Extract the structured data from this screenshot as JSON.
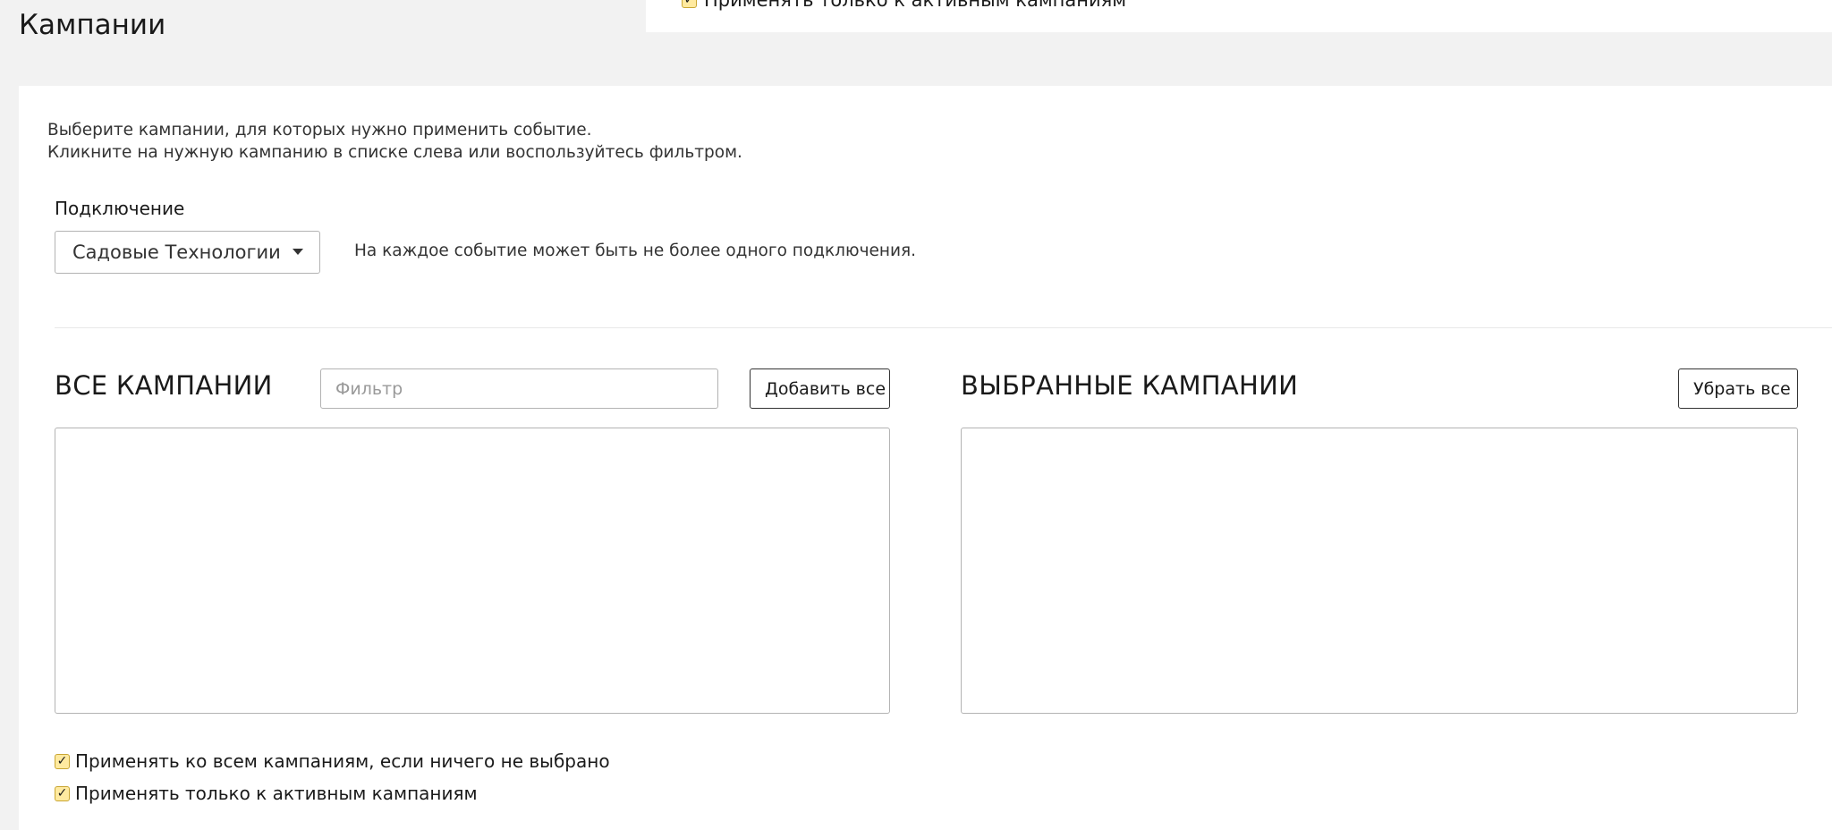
{
  "page": {
    "title": "Кампании"
  },
  "top_strip": {
    "ghost_checkbox_label": "Применять только к активным кампаниям"
  },
  "intro": {
    "line1": "Выберите кампании, для которых нужно применить событие.",
    "line2": "Кликните на нужную кампанию в списке слева или воспользуйтесь фильтром."
  },
  "connection": {
    "label": "Подключение",
    "selected_value": "Садовые Технологии",
    "note": "На каждое событие может быть не более одного подключения."
  },
  "all_campaigns": {
    "title": "ВСЕ КАМПАНИИ",
    "filter_placeholder": "Фильтр",
    "filter_value": "",
    "add_all_label": "Добавить все",
    "items": []
  },
  "selected_campaigns": {
    "title": "ВЫБРАННЫЕ КАМПАНИИ",
    "remove_all_label": "Убрать все",
    "items": []
  },
  "options": {
    "apply_all_label": "Применять ко всем кампаниям, если ничего не выбрано",
    "apply_all_checked": true,
    "only_active_label": "Применять только к активным кампаниям",
    "only_active_checked": true,
    "check_glyph": "✓"
  },
  "colors": {
    "checkbox_fill": "#ffeaa0",
    "checkbox_border": "#c9a633",
    "background": "#f2f2f2"
  }
}
